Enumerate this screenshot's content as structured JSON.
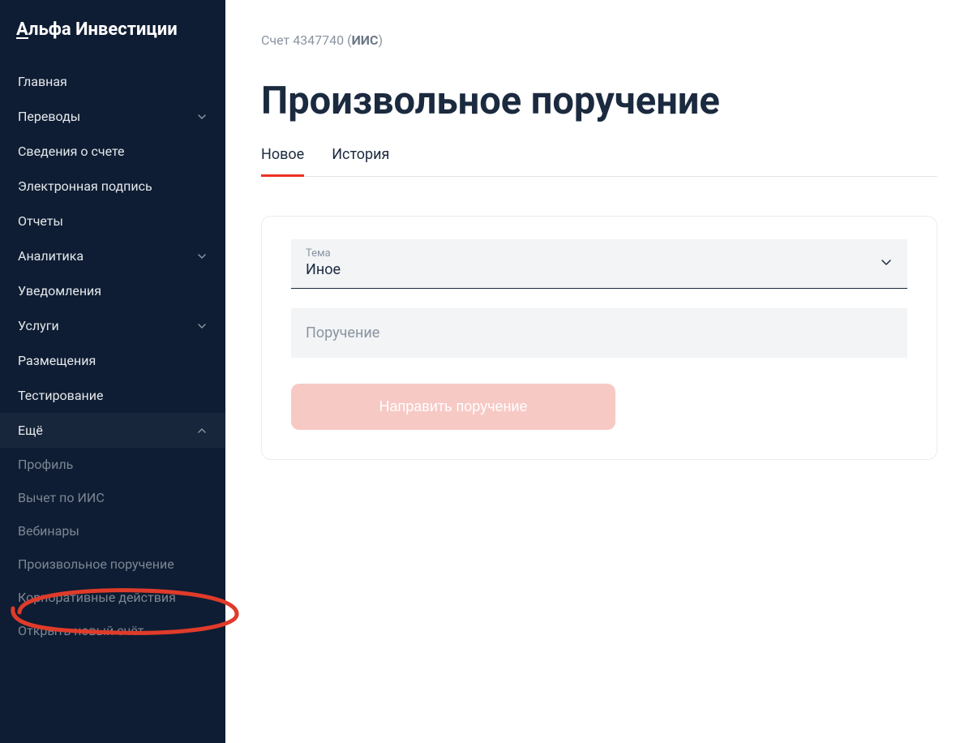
{
  "logo": {
    "prefix": "А",
    "rest": "льфа Инвестиции"
  },
  "sidebar": {
    "items": [
      {
        "label": "Главная",
        "chevron": null
      },
      {
        "label": "Переводы",
        "chevron": "down"
      },
      {
        "label": "Сведения о счете",
        "chevron": null
      },
      {
        "label": "Электронная подпись",
        "chevron": null
      },
      {
        "label": "Отчеты",
        "chevron": null
      },
      {
        "label": "Аналитика",
        "chevron": "down"
      },
      {
        "label": "Уведомления",
        "chevron": null
      },
      {
        "label": "Услуги",
        "chevron": "down"
      },
      {
        "label": "Размещения",
        "chevron": null
      },
      {
        "label": "Тестирование",
        "chevron": null
      },
      {
        "label": "Ещё",
        "chevron": "up",
        "expanded": true
      }
    ],
    "sub_items": [
      {
        "label": "Профиль"
      },
      {
        "label": "Вычет по ИИС"
      },
      {
        "label": "Вебинары"
      },
      {
        "label": "Произвольное поручение"
      },
      {
        "label": "Корпоративные действия"
      },
      {
        "label": "Открыть новый счёт"
      }
    ]
  },
  "breadcrumb": {
    "account_word": "Счет",
    "number": "4347740",
    "type": "ИИС"
  },
  "page_title": "Произвольное поручение",
  "tabs": [
    {
      "label": "Новое",
      "active": true
    },
    {
      "label": "История",
      "active": false
    }
  ],
  "form": {
    "topic_label": "Тема",
    "topic_value": "Иное",
    "instruction_placeholder": "Поручение",
    "submit_label": "Направить поручение"
  }
}
